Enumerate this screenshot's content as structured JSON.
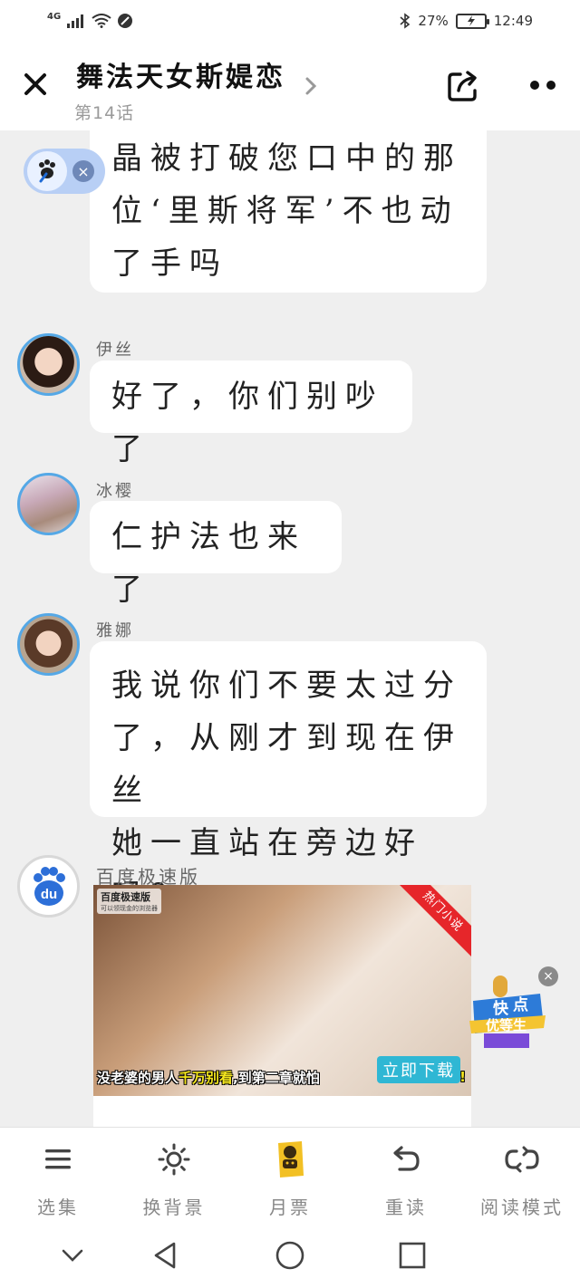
{
  "status_bar": {
    "network": "4G",
    "battery_percent": "27%",
    "time": "12:49"
  },
  "header": {
    "title": "舞法天女斯媞恋",
    "subtitle": "第14话",
    "close_icon": "close-icon",
    "share_icon": "share-icon",
    "more_icon": "more-icon"
  },
  "messages": [
    {
      "sender": "",
      "text": "晶被打破您口中的那位‘里斯将军’不也动了手吗",
      "lines": [
        "晶被打破您口中的那",
        "位‘里斯将军’不也动",
        "了手吗"
      ]
    },
    {
      "sender": "伊丝",
      "lines": [
        "好了，你们别吵了"
      ]
    },
    {
      "sender": "冰樱",
      "lines": [
        "仁护法也来了"
      ]
    },
    {
      "sender": "雅娜",
      "lines": [
        "我说你们不要太过分",
        "了，从刚才到现在伊丝",
        "她一直站在旁边好吗？"
      ]
    }
  ],
  "ad": {
    "advertiser": "百度极速版",
    "brand_text": "百度极速版",
    "brand_sub": "可以领现金的浏览器",
    "ribbon": "热门小说",
    "caption_pre": "没老婆的男人",
    "caption_highlight": "千万别看",
    "caption_post": ",到第二章就怕",
    "caption_end": "!",
    "download_label": "立即下载",
    "avatar_text": "du"
  },
  "float_badge": {
    "line1": "快",
    "line2": "点",
    "line3": "优等生",
    "close": "×"
  },
  "toolbar": {
    "items": [
      {
        "label": "选集",
        "icon": "menu-icon"
      },
      {
        "label": "换背景",
        "icon": "sun-icon"
      },
      {
        "label": "月票",
        "icon": "ticket-icon"
      },
      {
        "label": "重读",
        "icon": "undo-icon"
      },
      {
        "label": "阅读模式",
        "icon": "loop-icon"
      }
    ]
  },
  "colors": {
    "accent_blue": "#55a8e6",
    "chat_bg": "#efefef",
    "ribbon_red": "#e6262a",
    "download_cyan": "#2fb7d4"
  }
}
